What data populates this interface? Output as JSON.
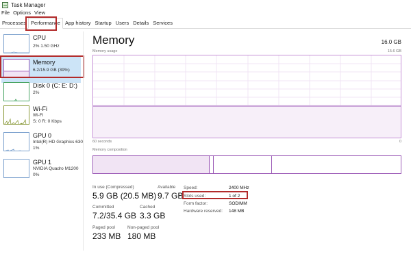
{
  "window": {
    "title": "Task Manager"
  },
  "menu": [
    "File",
    "Options",
    "View"
  ],
  "tabs": [
    "Processes",
    "Performance",
    "App history",
    "Startup",
    "Users",
    "Details",
    "Services"
  ],
  "sidebar": {
    "items": [
      {
        "title": "CPU",
        "subtitle": "2% 1.50 GHz"
      },
      {
        "title": "Memory",
        "subtitle": "6.2/15.9 GB (39%)"
      },
      {
        "title": "Disk 0 (C: E: D:)",
        "subtitle": "2%"
      },
      {
        "title": "Wi-Fi",
        "subtitle": "Wi-Fi",
        "subtitle2": "S: 0 R: 0 Kbps"
      },
      {
        "title": "GPU 0",
        "subtitle": "Intel(R) HD Graphics 630",
        "subtitle2": "1%"
      },
      {
        "title": "GPU 1",
        "subtitle": "NVIDIA Quadro M1200",
        "subtitle2": "0%"
      }
    ]
  },
  "main": {
    "title": "Memory",
    "total": "16.0 GB",
    "usage_label": "Memory usage",
    "usage_max": "15.6 GB",
    "time_left": "60 seconds",
    "time_right": "0",
    "composition_label": "Memory composition",
    "stats": {
      "in_use_label": "In use (Compressed)",
      "in_use_value": "5.9 GB (20.5 MB)",
      "available_label": "Available",
      "available_value": "9.7 GB",
      "committed_label": "Committed",
      "committed_value": "7.2/35.4 GB",
      "cached_label": "Cached",
      "cached_value": "3.3 GB",
      "paged_label": "Paged pool",
      "paged_value": "233 MB",
      "nonpaged_label": "Non-paged pool",
      "nonpaged_value": "180 MB"
    },
    "details": {
      "speed_label": "Speed:",
      "speed_value": "2400 MHz",
      "slots_label": "Slots used:",
      "slots_value": "1 of 2",
      "form_label": "Form factor:",
      "form_value": "SODIMM",
      "reserved_label": "Hardware reserved:",
      "reserved_value": "148 MB"
    }
  },
  "colors": {
    "accent_purple": "#9b59b6",
    "highlight": "#b22a2a",
    "selected": "#cce4f7"
  }
}
